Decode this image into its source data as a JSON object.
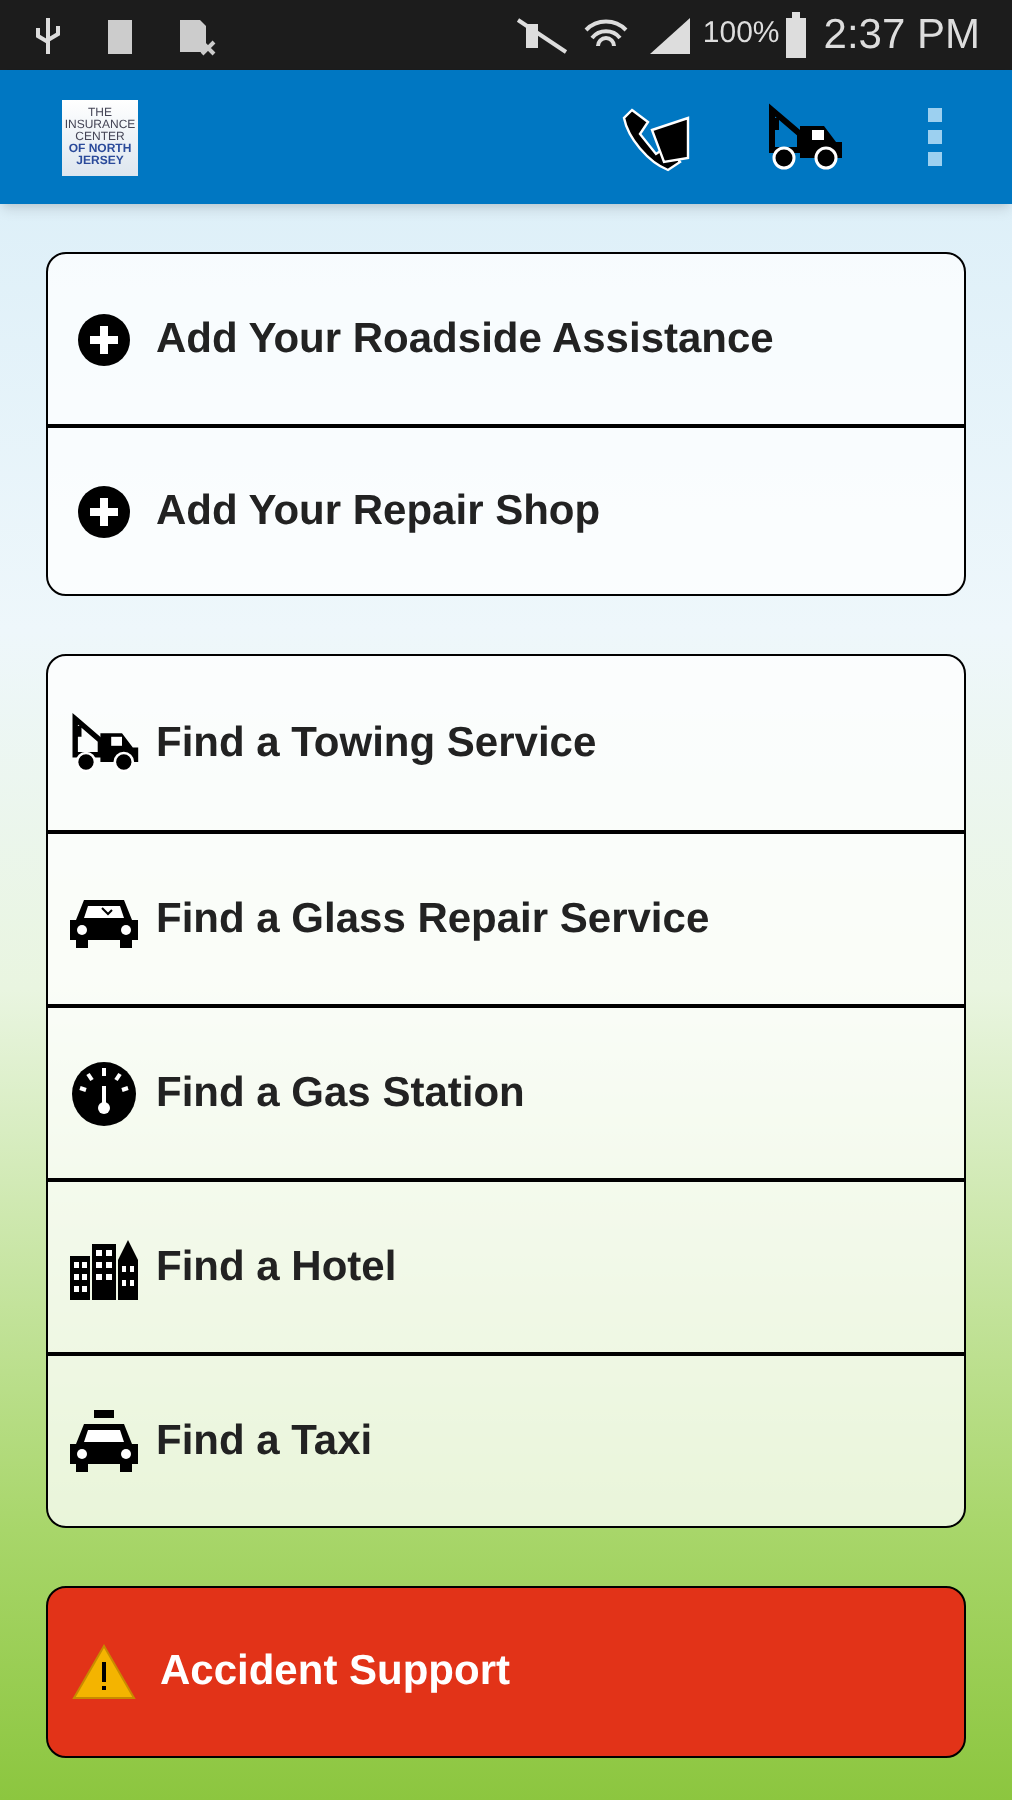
{
  "status_bar": {
    "battery": "100%",
    "time": "2:37 PM"
  },
  "app_bar": {
    "logo_lines": [
      "THE",
      "INSURANCE",
      "CENTER",
      "OF NORTH JERSEY"
    ]
  },
  "add_group": [
    {
      "kind": "plus",
      "label": "Add Your Roadside Assistance"
    },
    {
      "kind": "plus",
      "label": "Add Your Repair Shop"
    }
  ],
  "find_group": [
    {
      "kind": "tow",
      "label": "Find a Towing Service"
    },
    {
      "kind": "car",
      "label": "Find a Glass Repair Service"
    },
    {
      "kind": "gauge",
      "label": "Find a Gas Station"
    },
    {
      "kind": "hotel",
      "label": "Find a Hotel"
    },
    {
      "kind": "taxi",
      "label": "Find a Taxi"
    }
  ],
  "alert_button": {
    "label": "Accident Support"
  }
}
